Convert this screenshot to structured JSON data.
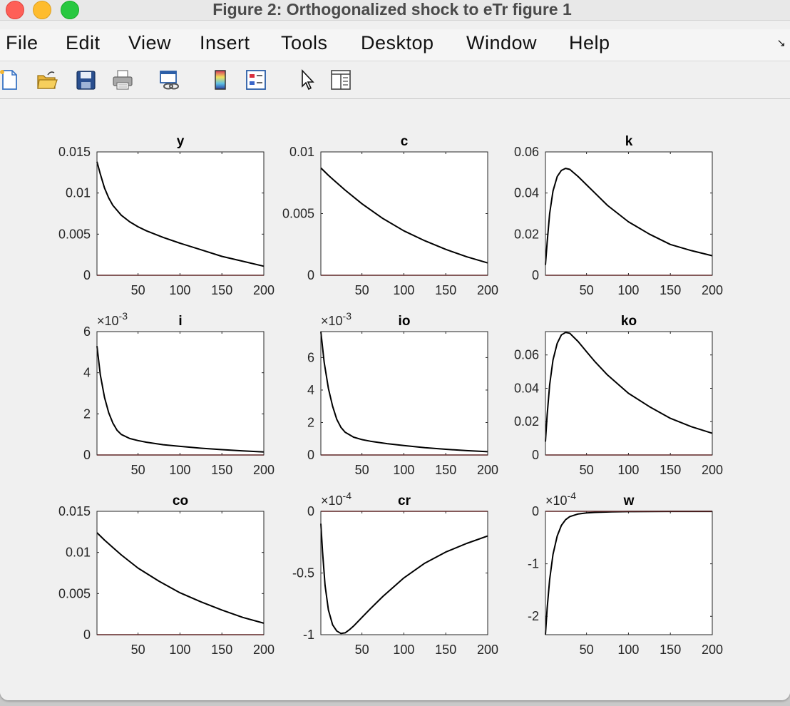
{
  "window": {
    "title": "Figure 2: Orthogonalized shock to eTr figure 1"
  },
  "menu": {
    "items": [
      "File",
      "Edit",
      "View",
      "Insert",
      "Tools",
      "Desktop",
      "Window",
      "Help"
    ],
    "corner_icon": "undock-arrow-icon"
  },
  "toolbar": {
    "tools": [
      "new-figure-icon",
      "open-file-icon",
      "save-icon",
      "print-icon",
      "link-plot-icon",
      "insert-colorbar-icon",
      "insert-legend-icon",
      "edit-plot-cursor-icon",
      "property-editor-icon"
    ]
  },
  "chart_data": [
    {
      "type": "line",
      "title": "y",
      "xlim": [
        1,
        200
      ],
      "ylim": [
        0,
        0.015
      ],
      "xticks": [
        50,
        100,
        150,
        200
      ],
      "xtick_labels": [
        "50",
        "100",
        "150",
        "200"
      ],
      "yticks": [
        0,
        0.005,
        0.01,
        0.015
      ],
      "ytick_labels": [
        "0",
        "0.005",
        "0.01",
        "0.015"
      ],
      "exponent": "",
      "series": [
        {
          "color": "#000000",
          "x": [
            1,
            5,
            10,
            15,
            20,
            30,
            40,
            50,
            60,
            80,
            100,
            125,
            150,
            175,
            200
          ],
          "y": [
            0.0138,
            0.0123,
            0.0106,
            0.0094,
            0.0085,
            0.0073,
            0.0065,
            0.0059,
            0.0054,
            0.0046,
            0.0039,
            0.0031,
            0.0023,
            0.0017,
            0.0011
          ]
        },
        {
          "color": "#cc2222",
          "x": [
            1,
            200
          ],
          "y": [
            0,
            0
          ]
        }
      ]
    },
    {
      "type": "line",
      "title": "c",
      "xlim": [
        1,
        200
      ],
      "ylim": [
        0,
        0.01
      ],
      "xticks": [
        50,
        100,
        150,
        200
      ],
      "xtick_labels": [
        "50",
        "100",
        "150",
        "200"
      ],
      "yticks": [
        0,
        0.005,
        0.01
      ],
      "ytick_labels": [
        "0",
        "0.005",
        "0.01"
      ],
      "exponent": "",
      "series": [
        {
          "color": "#000000",
          "x": [
            1,
            10,
            20,
            30,
            50,
            75,
            100,
            125,
            150,
            175,
            200
          ],
          "y": [
            0.0087,
            0.0081,
            0.0075,
            0.0069,
            0.0058,
            0.0046,
            0.0036,
            0.0028,
            0.0021,
            0.0015,
            0.001
          ]
        },
        {
          "color": "#cc2222",
          "x": [
            1,
            200
          ],
          "y": [
            0,
            0
          ]
        }
      ]
    },
    {
      "type": "line",
      "title": "k",
      "xlim": [
        1,
        200
      ],
      "ylim": [
        0,
        0.06
      ],
      "xticks": [
        50,
        100,
        150,
        200
      ],
      "xtick_labels": [
        "50",
        "100",
        "150",
        "200"
      ],
      "yticks": [
        0,
        0.02,
        0.04,
        0.06
      ],
      "ytick_labels": [
        "0",
        "0.02",
        "0.04",
        "0.06"
      ],
      "exponent": "",
      "series": [
        {
          "color": "#000000",
          "x": [
            1,
            3,
            6,
            10,
            15,
            20,
            25,
            30,
            40,
            50,
            60,
            75,
            100,
            125,
            150,
            175,
            200
          ],
          "y": [
            0.005,
            0.016,
            0.03,
            0.041,
            0.048,
            0.051,
            0.052,
            0.0515,
            0.048,
            0.044,
            0.04,
            0.034,
            0.026,
            0.02,
            0.015,
            0.012,
            0.0095
          ]
        },
        {
          "color": "#cc2222",
          "x": [
            1,
            200
          ],
          "y": [
            0,
            0
          ]
        }
      ]
    },
    {
      "type": "line",
      "title": "i",
      "xlim": [
        1,
        200
      ],
      "ylim": [
        0,
        6
      ],
      "xticks": [
        50,
        100,
        150,
        200
      ],
      "xtick_labels": [
        "50",
        "100",
        "150",
        "200"
      ],
      "yticks": [
        0,
        2,
        4,
        6
      ],
      "ytick_labels": [
        "0",
        "2",
        "4",
        "6"
      ],
      "exponent": "-3",
      "series": [
        {
          "color": "#000000",
          "x": [
            1,
            5,
            10,
            15,
            20,
            25,
            30,
            40,
            50,
            60,
            80,
            100,
            125,
            150,
            175,
            200
          ],
          "y": [
            5.3,
            3.9,
            2.8,
            2.05,
            1.55,
            1.2,
            1.0,
            0.8,
            0.7,
            0.62,
            0.5,
            0.42,
            0.33,
            0.26,
            0.2,
            0.15
          ]
        },
        {
          "color": "#cc2222",
          "x": [
            1,
            200
          ],
          "y": [
            0,
            0
          ]
        }
      ]
    },
    {
      "type": "line",
      "title": "io",
      "xlim": [
        1,
        200
      ],
      "ylim": [
        0,
        7.6
      ],
      "xticks": [
        50,
        100,
        150,
        200
      ],
      "xtick_labels": [
        "50",
        "100",
        "150",
        "200"
      ],
      "yticks": [
        0,
        2,
        4,
        6
      ],
      "ytick_labels": [
        "0",
        "2",
        "4",
        "6"
      ],
      "exponent": "-3",
      "series": [
        {
          "color": "#000000",
          "x": [
            1,
            5,
            10,
            15,
            20,
            25,
            30,
            40,
            50,
            60,
            80,
            100,
            125,
            150,
            175,
            200
          ],
          "y": [
            7.6,
            5.7,
            4.1,
            3.0,
            2.2,
            1.7,
            1.4,
            1.1,
            0.95,
            0.85,
            0.7,
            0.58,
            0.45,
            0.35,
            0.27,
            0.2
          ]
        },
        {
          "color": "#cc2222",
          "x": [
            1,
            200
          ],
          "y": [
            0,
            0
          ]
        }
      ]
    },
    {
      "type": "line",
      "title": "ko",
      "xlim": [
        1,
        200
      ],
      "ylim": [
        0,
        0.074
      ],
      "xticks": [
        50,
        100,
        150,
        200
      ],
      "xtick_labels": [
        "50",
        "100",
        "150",
        "200"
      ],
      "yticks": [
        0,
        0.02,
        0.04,
        0.06
      ],
      "ytick_labels": [
        "0",
        "0.02",
        "0.04",
        "0.06"
      ],
      "exponent": "",
      "series": [
        {
          "color": "#000000",
          "x": [
            1,
            3,
            6,
            10,
            15,
            20,
            25,
            30,
            40,
            50,
            60,
            75,
            100,
            125,
            150,
            175,
            200
          ],
          "y": [
            0.008,
            0.024,
            0.042,
            0.057,
            0.067,
            0.072,
            0.0735,
            0.073,
            0.068,
            0.062,
            0.056,
            0.048,
            0.037,
            0.029,
            0.022,
            0.017,
            0.013
          ]
        },
        {
          "color": "#cc2222",
          "x": [
            1,
            200
          ],
          "y": [
            0,
            0
          ]
        }
      ]
    },
    {
      "type": "line",
      "title": "co",
      "xlim": [
        1,
        200
      ],
      "ylim": [
        0,
        0.015
      ],
      "xticks": [
        50,
        100,
        150,
        200
      ],
      "xtick_labels": [
        "50",
        "100",
        "150",
        "200"
      ],
      "yticks": [
        0,
        0.005,
        0.01,
        0.015
      ],
      "ytick_labels": [
        "0",
        "0.005",
        "0.01",
        "0.015"
      ],
      "exponent": "",
      "series": [
        {
          "color": "#000000",
          "x": [
            1,
            10,
            20,
            30,
            50,
            75,
            100,
            125,
            150,
            175,
            200
          ],
          "y": [
            0.0124,
            0.0115,
            0.0106,
            0.0097,
            0.0081,
            0.0065,
            0.0051,
            0.004,
            0.003,
            0.0021,
            0.0014
          ]
        },
        {
          "color": "#cc2222",
          "x": [
            1,
            200
          ],
          "y": [
            0,
            0
          ]
        }
      ]
    },
    {
      "type": "line",
      "title": "cr",
      "xlim": [
        1,
        200
      ],
      "ylim": [
        -1,
        0
      ],
      "xticks": [
        50,
        100,
        150,
        200
      ],
      "xtick_labels": [
        "50",
        "100",
        "150",
        "200"
      ],
      "yticks": [
        -1,
        -0.5,
        0
      ],
      "ytick_labels": [
        "-1",
        "-0.5",
        "0"
      ],
      "exponent": "-4",
      "series": [
        {
          "color": "#000000",
          "x": [
            1,
            3,
            6,
            10,
            15,
            20,
            25,
            30,
            35,
            40,
            50,
            60,
            75,
            100,
            125,
            150,
            175,
            200
          ],
          "y": [
            -0.1,
            -0.33,
            -0.6,
            -0.8,
            -0.92,
            -0.97,
            -0.99,
            -0.985,
            -0.96,
            -0.93,
            -0.86,
            -0.79,
            -0.69,
            -0.54,
            -0.42,
            -0.33,
            -0.26,
            -0.2
          ]
        },
        {
          "color": "#cc2222",
          "x": [
            1,
            200
          ],
          "y": [
            0,
            0
          ]
        }
      ]
    },
    {
      "type": "line",
      "title": "w",
      "xlim": [
        1,
        200
      ],
      "ylim": [
        -2.35,
        0
      ],
      "xticks": [
        50,
        100,
        150,
        200
      ],
      "xtick_labels": [
        "50",
        "100",
        "150",
        "200"
      ],
      "yticks": [
        -2,
        -1,
        0
      ],
      "ytick_labels": [
        "-2",
        "-1",
        "0"
      ],
      "exponent": "-4",
      "series": [
        {
          "color": "#000000",
          "x": [
            1,
            3,
            6,
            10,
            15,
            20,
            25,
            30,
            40,
            50,
            60,
            80,
            100,
            150,
            200
          ],
          "y": [
            -2.35,
            -1.85,
            -1.3,
            -0.82,
            -0.47,
            -0.27,
            -0.16,
            -0.1,
            -0.05,
            -0.03,
            -0.02,
            -0.01,
            -0.005,
            -0.002,
            -0.001
          ]
        },
        {
          "color": "#cc2222",
          "x": [
            1,
            200
          ],
          "y": [
            0,
            0
          ]
        }
      ]
    }
  ]
}
